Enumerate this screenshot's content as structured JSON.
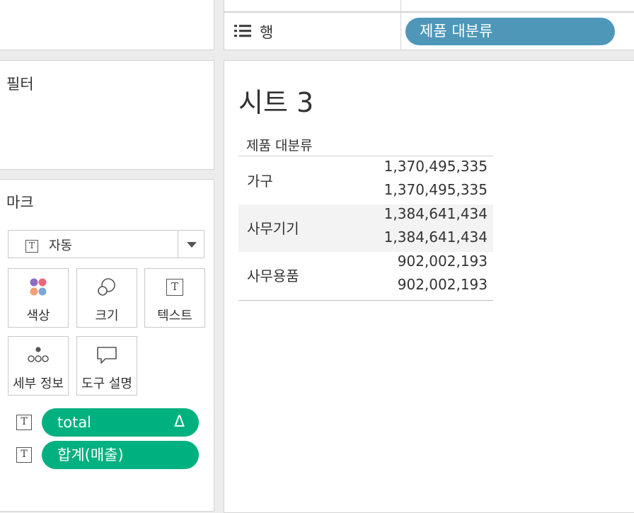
{
  "left": {
    "filters_title": "필터",
    "marks_title": "마크",
    "mark_type": "자동",
    "cards": [
      {
        "label": "색상",
        "icon": "color-dots-icon"
      },
      {
        "label": "크기",
        "icon": "size-circles-icon"
      },
      {
        "label": "텍스트",
        "icon": "text-t-icon"
      },
      {
        "label": "세부 정보",
        "icon": "detail-dots-icon"
      },
      {
        "label": "도구 설명",
        "icon": "tooltip-bubble-icon"
      }
    ],
    "mark_fields": [
      {
        "label": "total",
        "icon": "text-t-icon",
        "badge": "Δ"
      },
      {
        "label": "합계(매출)",
        "icon": "text-t-icon"
      }
    ]
  },
  "shelf": {
    "rows_label": "행",
    "rows_pill": "제품 대분류"
  },
  "sheet": {
    "title": "시트 3",
    "row_header": "제품 대분류",
    "rows": [
      {
        "category": "가구",
        "values": [
          "1,370,495,335",
          "1,370,495,335"
        ]
      },
      {
        "category": "사무기기",
        "values": [
          "1,384,641,434",
          "1,384,641,434"
        ]
      },
      {
        "category": "사무용품",
        "values": [
          "902,002,193",
          "902,002,193"
        ]
      }
    ]
  },
  "colors": {
    "green_pill": "#00b180",
    "blue_pill": "#4e97b9",
    "band": "#f3f3f3"
  }
}
